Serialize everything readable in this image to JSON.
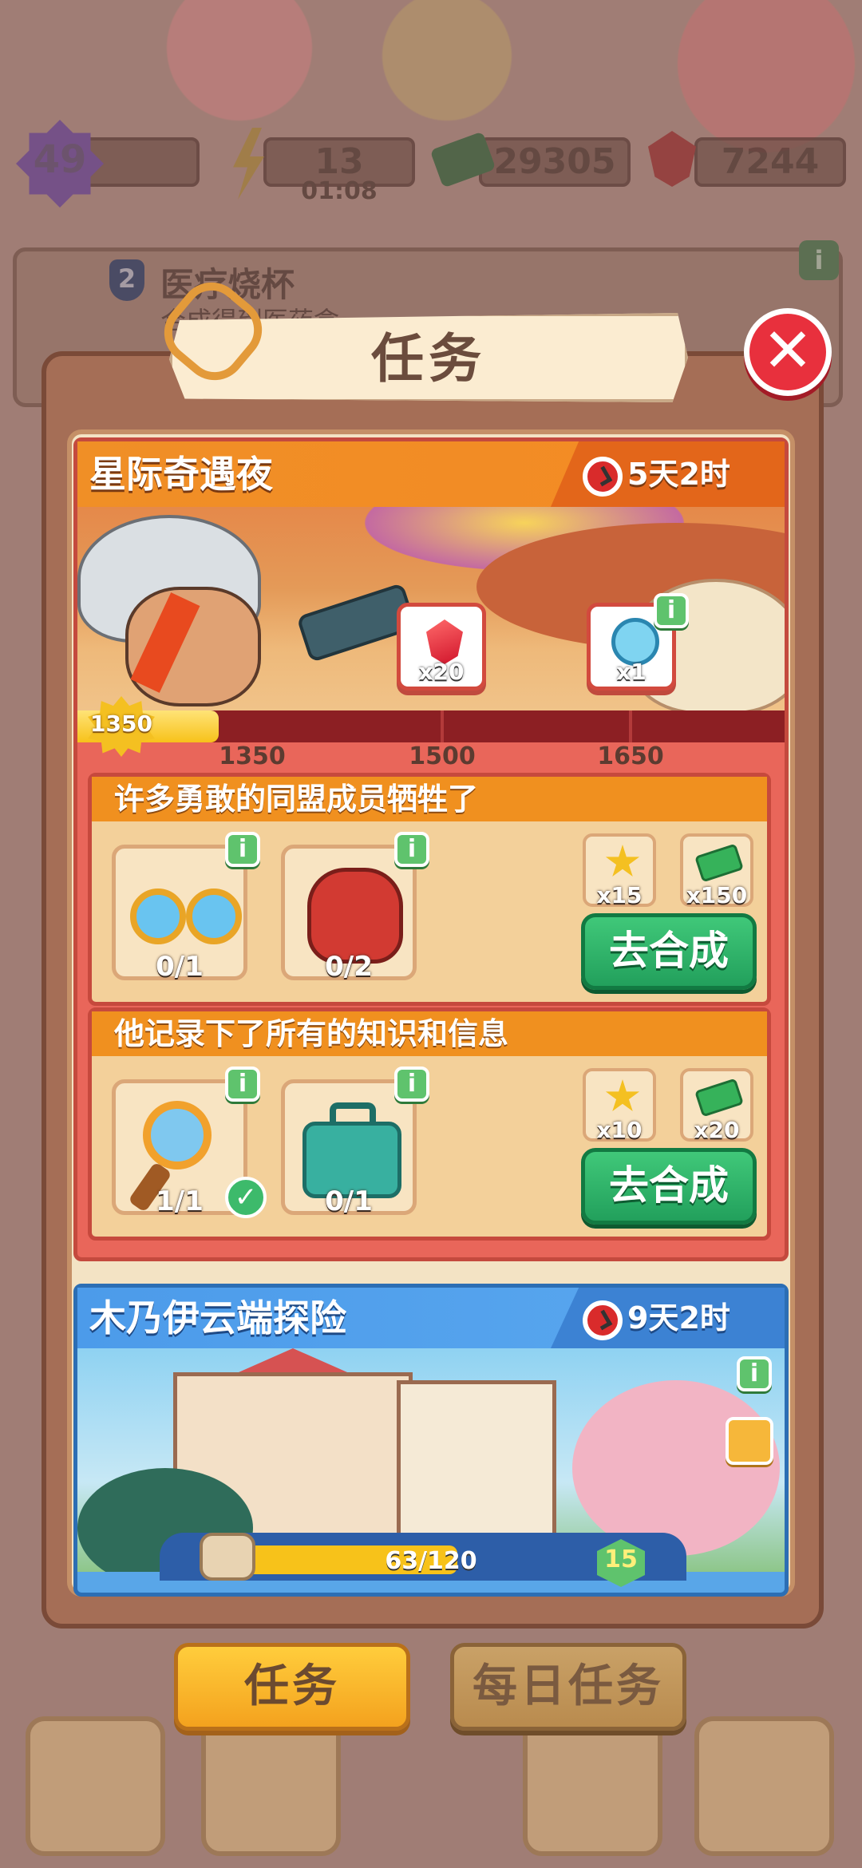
{
  "hud": {
    "level": "49",
    "energy": "13",
    "energy_timer": "01:08",
    "cash": "29305",
    "gems": "7244"
  },
  "background_item": {
    "level": "2",
    "name": "医疗烧杯",
    "subtitle": "合成得到医药盒"
  },
  "dialog": {
    "title": "任务",
    "close_icon": "close-icon"
  },
  "event1": {
    "title": "星际奇遇夜",
    "timer": "5天2时",
    "rewards": [
      {
        "icon": "ruby-gem-icon",
        "label": "x20"
      },
      {
        "icon": "scissors-icon",
        "label": "x1"
      }
    ],
    "progress": {
      "current": "1350",
      "fraction": 0.2,
      "ticks": [
        "1350",
        "1500",
        "1650"
      ]
    },
    "tasks": [
      {
        "title": "许多勇敢的同盟成员牺牲了",
        "items": [
          {
            "icon": "goggles-icon",
            "count": "0/1"
          },
          {
            "icon": "gloves-icon",
            "count": "0/2"
          }
        ],
        "rewards": [
          {
            "icon": "star-token-icon",
            "label": "x15"
          },
          {
            "icon": "cash-icon",
            "label": "x150"
          }
        ],
        "button": "去合成"
      },
      {
        "title": "他记录下了所有的知识和信息",
        "items": [
          {
            "icon": "magnifier-icon",
            "count": "1/1"
          },
          {
            "icon": "medkit-icon",
            "count": "0/1"
          }
        ],
        "rewards": [
          {
            "icon": "star-token-icon",
            "label": "x10"
          },
          {
            "icon": "cash-icon",
            "label": "x20"
          }
        ],
        "button": "去合成"
      }
    ]
  },
  "event2": {
    "title": "木乃伊云端探险",
    "timer": "9天2时",
    "progress_text": "63/120",
    "level_badge": "15"
  },
  "tabs": {
    "active": "任务",
    "inactive": "每日任务"
  },
  "colors": {
    "event1_header": "#f08f26",
    "event2_header": "#4c9bea",
    "go_button": "#22a05c",
    "close_button": "#e8303d"
  }
}
